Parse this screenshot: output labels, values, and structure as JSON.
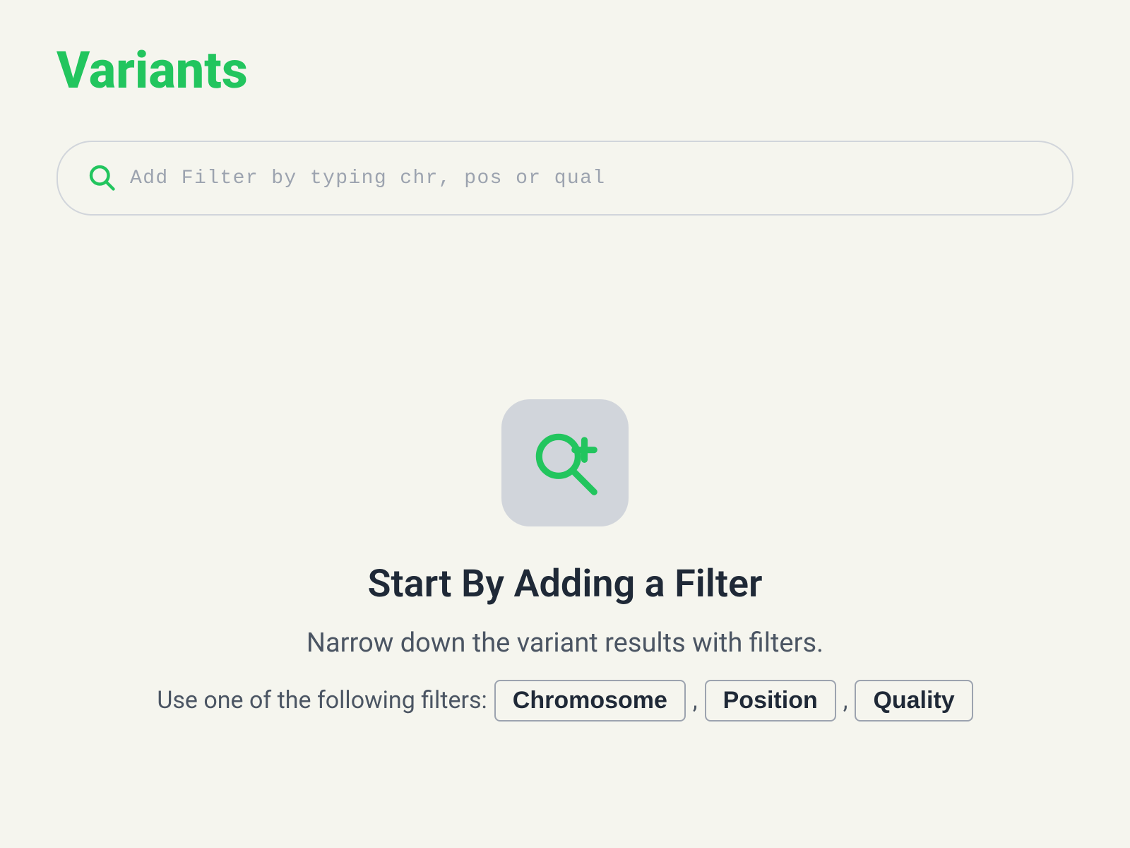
{
  "page": {
    "title": "Variants",
    "title_color": "#22c55e"
  },
  "search": {
    "placeholder": "Add Filter by typing chr, pos or qual",
    "icon": "search-icon"
  },
  "empty_state": {
    "icon": "search-plus-icon",
    "title": "Start By Adding a Filter",
    "subtitle": "Narrow down the variant results with filters.",
    "filter_prompt": "Use one of the following filters:",
    "filters": [
      {
        "label": "Chromosome",
        "key": "chromosome"
      },
      {
        "label": "Position",
        "key": "position"
      },
      {
        "label": "Quality",
        "key": "quality"
      }
    ]
  },
  "colors": {
    "accent": "#22c55e",
    "background": "#f5f5ee"
  }
}
